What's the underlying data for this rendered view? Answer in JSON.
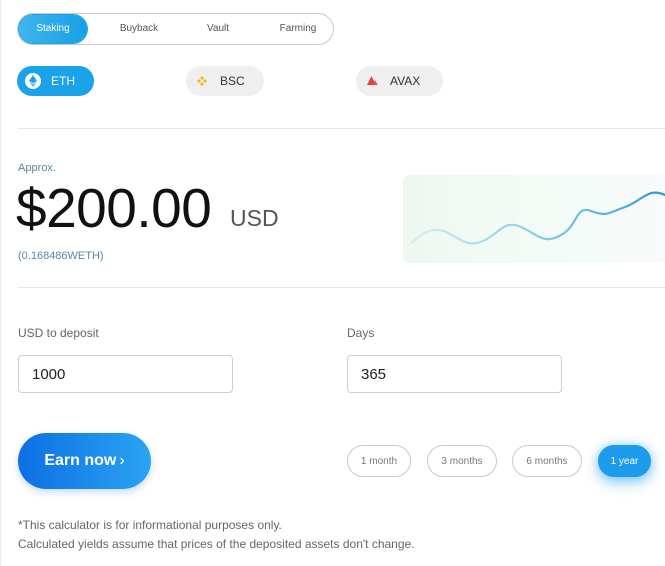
{
  "tabs": [
    {
      "label": "Staking",
      "active": true
    },
    {
      "label": "Buyback",
      "active": false
    },
    {
      "label": "Vault",
      "active": false
    },
    {
      "label": "Farming",
      "active": false
    }
  ],
  "chains": [
    {
      "label": "ETH",
      "icon": "eth-icon",
      "active": true
    },
    {
      "label": "BSC",
      "icon": "bnb-icon",
      "active": false
    },
    {
      "label": "AVAX",
      "icon": "avax-icon",
      "active": false
    }
  ],
  "estimate": {
    "approx_label": "Approx.",
    "amount": "$200.00",
    "unit": "USD",
    "token_amount": "(0.168486WETH)"
  },
  "form": {
    "usd_label": "USD to deposit",
    "usd_value": "1000",
    "days_label": "Days",
    "days_value": "365"
  },
  "earn_button": {
    "label": "Earn now",
    "chevron": "›"
  },
  "periods": [
    {
      "label": "1 month",
      "active": false
    },
    {
      "label": "3 months",
      "active": false
    },
    {
      "label": "6 months",
      "active": false
    },
    {
      "label": "1 year",
      "active": true
    }
  ],
  "disclaimer": {
    "line1": "*This calculator is for informational purposes only.",
    "line2": "Calculated yields assume that prices of the deposited assets don't change."
  },
  "colors": {
    "accent": "#1aa3e8",
    "button_gradient_start": "#0d6fe3",
    "button_gradient_end": "#2aa4f2",
    "bnb": "#f0b90b",
    "avax": "#e84142"
  }
}
